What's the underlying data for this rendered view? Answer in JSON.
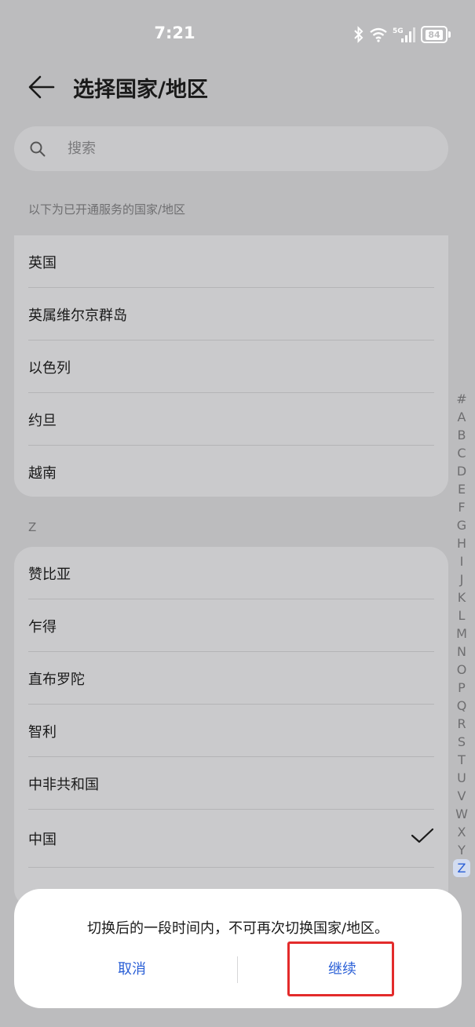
{
  "status_bar": {
    "time": "7:21",
    "battery": "84",
    "network": "5G"
  },
  "header": {
    "title": "选择国家/地区"
  },
  "search": {
    "placeholder": "搜索"
  },
  "section_intro": "以下为已开通服务的国家/地区",
  "top_list": [
    "英国",
    "英属维尔京群岛",
    "以色列",
    "约旦",
    "越南"
  ],
  "section_z": "Z",
  "z_list": [
    {
      "label": "赞比亚"
    },
    {
      "label": "乍得"
    },
    {
      "label": "直布罗陀"
    },
    {
      "label": "智利"
    },
    {
      "label": "中非共和国"
    },
    {
      "label": "中国",
      "selected": true
    }
  ],
  "index_letters": [
    "#",
    "A",
    "B",
    "C",
    "D",
    "E",
    "F",
    "G",
    "H",
    "I",
    "J",
    "K",
    "L",
    "M",
    "N",
    "O",
    "P",
    "Q",
    "R",
    "S",
    "T",
    "U",
    "V",
    "W",
    "X",
    "Y",
    "Z"
  ],
  "index_active": "Z",
  "dialog": {
    "message": "切换后的一段时间内，不可再次切换国家/地区。",
    "cancel_label": "取消",
    "continue_label": "继续"
  },
  "colors": {
    "accent": "#2a5fd6",
    "highlight": "#e32b2b",
    "dim_background": "#bcbcbe"
  }
}
